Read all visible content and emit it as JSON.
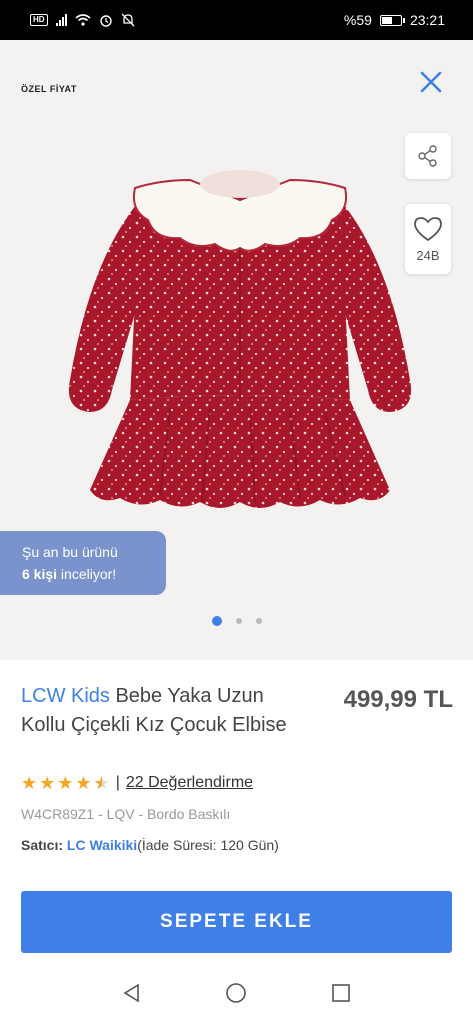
{
  "status_bar": {
    "hd": "HD",
    "battery_text": "%59",
    "battery_level": 0.59,
    "time": "23:21"
  },
  "product": {
    "special_price_label": "ÖZEL FİYAT",
    "favorite_count": "24B",
    "viewers_line1": "Şu an bu ürünü",
    "viewers_count": "6 kişi",
    "viewers_line2_rest": " inceliyor!",
    "brand": "LCW Kids",
    "name": " Bebe Yaka Uzun Kollu Çiçekli Kız Çocuk Elbise",
    "price": "499,99 TL",
    "rating_value": 4.5,
    "rating_separator": "|",
    "reviews_label": "22 Değerlendirme",
    "sku": "W4CR89Z1 - LQV - Bordo Baskılı",
    "seller_label": "Satıcı:",
    "seller_name": "LC Waikiki",
    "return_info": "(İade Süresi: 120 Gün)",
    "add_to_cart": "SEPETE EKLE",
    "image_count": 3,
    "active_image": 1
  },
  "colors": {
    "accent": "#3f7fe8",
    "badge": "#7a93cc",
    "dress": "#a8182a",
    "star": "#f5a623"
  },
  "icons": {
    "close": "close-icon",
    "share": "share-icon",
    "favorite": "heart-icon",
    "nav_back": "back-triangle-icon",
    "nav_home": "home-circle-icon",
    "nav_recents": "recents-square-icon"
  }
}
